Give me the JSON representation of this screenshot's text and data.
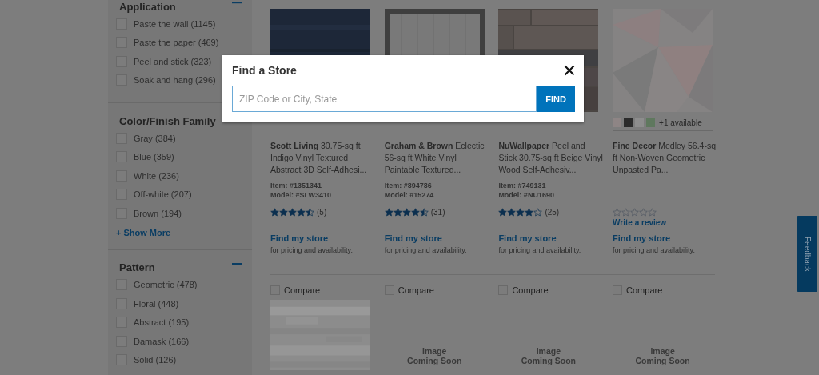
{
  "filters": [
    {
      "title": "Application",
      "collapsible": true,
      "options": [
        {
          "label": "Paste the wall (1145)",
          "checked": false
        },
        {
          "label": "Paste the paper (469)",
          "checked": false
        },
        {
          "label": "Peel and stick (323)",
          "checked": false
        },
        {
          "label": "Soak and hang (296)",
          "checked": false
        }
      ]
    },
    {
      "title": "Color/Finish Family",
      "collapsible": false,
      "options": [
        {
          "label": "Gray (384)",
          "checked": false
        },
        {
          "label": "Blue (359)",
          "checked": false
        },
        {
          "label": "White (236)",
          "checked": false
        },
        {
          "label": "Off-white (207)",
          "checked": false
        },
        {
          "label": "Brown (194)",
          "checked": false
        }
      ],
      "show_more": "+ Show More"
    },
    {
      "title": "Pattern",
      "collapsible": true,
      "options": [
        {
          "label": "Geometric (478)",
          "checked": false
        },
        {
          "label": "Floral (448)",
          "checked": false
        },
        {
          "label": "Abstract (195)",
          "checked": false
        },
        {
          "label": "Damask (166)",
          "checked": false
        },
        {
          "label": "Solid (126)",
          "checked": false
        }
      ]
    }
  ],
  "products": [
    {
      "kind": "picture",
      "title": "**Scott Living** 30.75-sq ft Indigo Vinyl Textured Abstract 3D Self-Adhesi...",
      "item": "Item: #1351341",
      "model": "Model: #SLW3410",
      "stars": 4.5,
      "reviews": "(5)",
      "find_store": "Find my store",
      "note": "for pricing and availability.",
      "compare": {
        "label": "Compare",
        "checked": false
      }
    },
    {
      "kind": "picture",
      "title": "**Graham & Brown** Eclectic 56-sq ft White Vinyl Paintable Textured...",
      "item": "Item: #894786",
      "model": "Model: #15274",
      "stars": 4.5,
      "reviews": "(31)",
      "find_store": "Find my store",
      "note": "for pricing and availability.",
      "compare": {
        "label": "Compare",
        "checked": false
      }
    },
    {
      "kind": "picture",
      "title": "**NuWallpaper** Peel and Stick 30.75-sq ft Beige Vinyl Wood Self-Adhesiv...",
      "item": "Item: #749131",
      "model": "Model: #NU1690",
      "stars": 4,
      "reviews": "(25)",
      "find_store": "Find my store",
      "note": "for pricing and availability.",
      "compare": {
        "label": "Compare",
        "checked": false
      }
    },
    {
      "kind": "picture",
      "swatches": [
        {
          "color": "#8e8585"
        },
        {
          "color": "#2b2b2b"
        },
        {
          "color": "#8d8d8d"
        },
        {
          "color": "#5f785e"
        }
      ],
      "more_available": "+1 available",
      "title": "**Fine Decor** Medley 56.4-sq ft Non-Woven Geometric Unpasted Pa...",
      "stars": 0,
      "review_link": "Write a review",
      "find_store": "Find my store",
      "note": "for pricing and availability.",
      "compare": {
        "label": "Compare",
        "checked": false
      }
    }
  ],
  "next_row": [
    {
      "kind": "picture"
    },
    {
      "kind": "placeholder",
      "text": "Image\nComing Soon"
    },
    {
      "kind": "placeholder",
      "text": "Image\nComing Soon"
    },
    {
      "kind": "placeholder",
      "text": "Image\nComing Soon"
    }
  ],
  "feedback_tab": "Feedback",
  "dialog": {
    "title": "Find a Store",
    "placeholder": "ZIP Code or City, State",
    "button": "FIND"
  }
}
